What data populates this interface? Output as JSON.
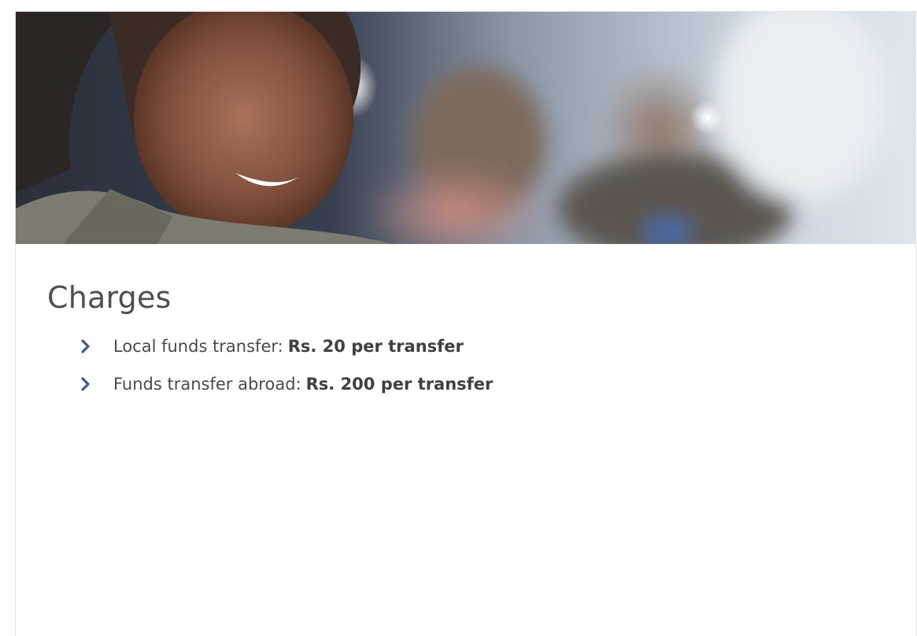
{
  "section": {
    "title": "Charges"
  },
  "charges": [
    {
      "label": "Local funds transfer:",
      "value": "Rs. 20 per transfer"
    },
    {
      "label": "Funds transfer abroad:",
      "value": "Rs. 200 per transfer"
    }
  ],
  "icons": {
    "bullet": "chevron-right-icon"
  },
  "colors": {
    "title_text": "#4f4f4f",
    "body_text": "#4a4a4a",
    "chevron": "#3b5b8c",
    "border": "#e2e2e2"
  }
}
